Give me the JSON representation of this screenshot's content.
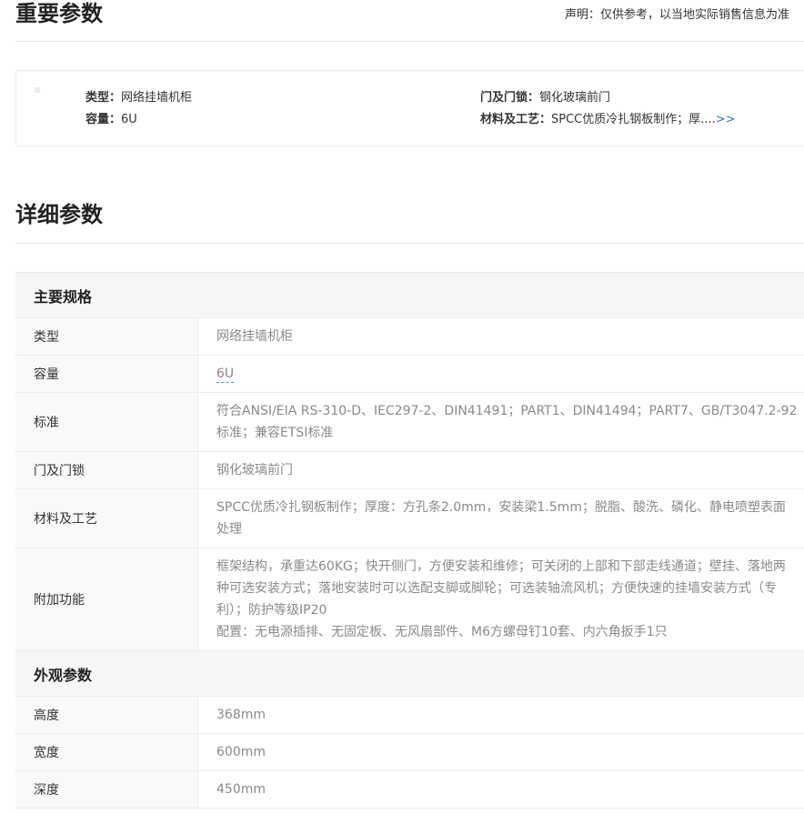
{
  "important": {
    "title": "重要参数",
    "disclaimer": "声明：仅供参考，以当地实际销售信息为准",
    "items": [
      {
        "key": "类型：",
        "value": "网络挂墙机柜"
      },
      {
        "key": "容量：",
        "value": "6U"
      },
      {
        "key": "门及门锁：",
        "value": "钢化玻璃前门"
      },
      {
        "key": "材料及工艺：",
        "value": "SPCC优质冷扎钢板制作；厚....",
        "more": ">>"
      }
    ]
  },
  "detail": {
    "title": "详细参数",
    "groups": [
      {
        "name": "主要规格",
        "rows": [
          {
            "key": "类型",
            "lines": [
              "网络挂墙机柜"
            ]
          },
          {
            "key": "容量",
            "lines": [
              "6U"
            ]
          },
          {
            "key": "标准",
            "lines": [
              "符合ANSI/EIA RS-310-D、IEC297-2、DIN41491；PART1、DIN41494；PART7、GB/T3047.2-92",
              "标准；兼容ETSI标准"
            ]
          },
          {
            "key": "门及门锁",
            "lines": [
              "钢化玻璃前门"
            ]
          },
          {
            "key": "材料及工艺",
            "lines": [
              "SPCC优质冷扎钢板制作；厚度：方孔条2.0mm，安装梁1.5mm；脱脂、酸洗、磷化、静电喷塑表面",
              "处理"
            ]
          },
          {
            "key": "附加功能",
            "lines": [
              "框架结构，承重达60KG；快开侧门，方便安装和维修；可关闭的上部和下部走线通道；壁挂、落地两",
              "种可选安装方式；落地安装时可以选配支脚或脚轮；可选装轴流风机；方便快速的挂墙安装方式（专",
              "利）；防护等级IP20",
              "配置：无电源插排、无固定板、无风扇部件、M6方螺母钉10套、内六角扳手1只"
            ]
          }
        ]
      },
      {
        "name": "外观参数",
        "rows": [
          {
            "key": "高度",
            "lines": [
              "368mm"
            ]
          },
          {
            "key": "宽度",
            "lines": [
              "600mm"
            ]
          },
          {
            "key": "深度",
            "lines": [
              "450mm"
            ]
          }
        ]
      }
    ]
  }
}
